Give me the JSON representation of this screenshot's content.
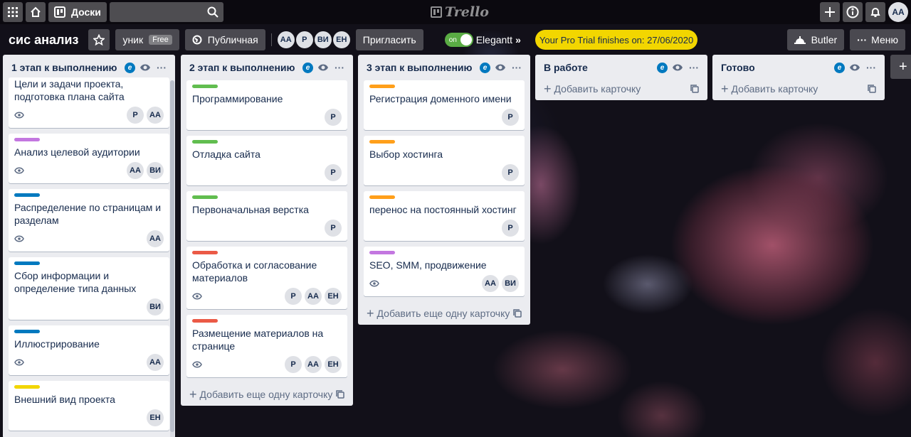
{
  "topbar": {
    "boards_label": "Доски",
    "search_placeholder": "",
    "logo_text": "Trello",
    "user_initials": "AA"
  },
  "board": {
    "title": "сис анализ",
    "team_label": "уник",
    "team_badge": "Free",
    "visibility_label": "Публичная",
    "members": [
      "AA",
      "P",
      "ВИ",
      "ЕН"
    ],
    "invite_label": "Пригласить",
    "toggle_state": "on",
    "powerup_label": "Elegantt",
    "pro_trial_text": "Your Pro Trial finishes on: 27/06/2020",
    "butler_label": "Butler",
    "menu_label": "Меню"
  },
  "colors": {
    "green": "#61bd4f",
    "purple": "#c377e0",
    "blue": "#0079bf",
    "yellow": "#f2d600",
    "orange": "#ff9f1a",
    "red": "#eb5a46"
  },
  "lists": [
    {
      "title": "1 этап к выполнению",
      "cards": [
        {
          "label": "",
          "title": "Цели и задачи проекта, подготовка плана сайта",
          "watch": true,
          "members": [
            "P",
            "AA"
          ]
        },
        {
          "label": "#c377e0",
          "title": "Анализ целевой аудитории",
          "watch": true,
          "members": [
            "AA",
            "ВИ"
          ]
        },
        {
          "label": "#0079bf",
          "title": "Распределение по страницам и разделам",
          "watch": true,
          "members": [
            "AA"
          ]
        },
        {
          "label": "#0079bf",
          "title": "Сбор информации и определение типа данных",
          "watch": false,
          "members": [
            "ВИ"
          ]
        },
        {
          "label": "#0079bf",
          "title": "Иллюстрирование",
          "watch": true,
          "members": [
            "AA"
          ]
        },
        {
          "label": "#f2d600",
          "title": "Внешний вид проекта",
          "watch": false,
          "members": [
            "ЕН"
          ]
        },
        {
          "label": "#f2d600",
          "title": "",
          "watch": false,
          "members": []
        }
      ],
      "add_label": ""
    },
    {
      "title": "2 этап к выполнению",
      "cards": [
        {
          "label": "#61bd4f",
          "title": "Программирование",
          "watch": false,
          "members": [
            "P"
          ]
        },
        {
          "label": "#61bd4f",
          "title": "Отладка сайта",
          "watch": false,
          "members": [
            "P"
          ]
        },
        {
          "label": "#61bd4f",
          "title": "Первоначальная верстка",
          "watch": false,
          "members": [
            "P"
          ]
        },
        {
          "label": "#eb5a46",
          "title": "Обработка и согласование материалов",
          "watch": true,
          "members": [
            "P",
            "AA",
            "ЕН"
          ]
        },
        {
          "label": "#eb5a46",
          "title": "Размещение материалов на странице",
          "watch": true,
          "members": [
            "P",
            "AA",
            "ЕН"
          ]
        }
      ],
      "add_label": "Добавить еще одну карточку"
    },
    {
      "title": "3 этап к выполнению",
      "cards": [
        {
          "label": "#ff9f1a",
          "title": "Регистрация доменного имени",
          "watch": false,
          "members": [
            "P"
          ]
        },
        {
          "label": "#ff9f1a",
          "title": "Выбор хостинга",
          "watch": false,
          "members": [
            "P"
          ]
        },
        {
          "label": "#ff9f1a",
          "title": "перенос на постоянный хостинг",
          "watch": false,
          "members": [
            "P"
          ]
        },
        {
          "label": "#c377e0",
          "title": "SEO, SMM, продвижение",
          "watch": true,
          "members": [
            "AA",
            "ВИ"
          ]
        }
      ],
      "add_label": "Добавить еще одну карточку"
    },
    {
      "title": "В работе",
      "cards": [],
      "add_label": "Добавить карточку"
    },
    {
      "title": "Готово",
      "cards": [],
      "add_label": "Добавить карточку"
    }
  ]
}
